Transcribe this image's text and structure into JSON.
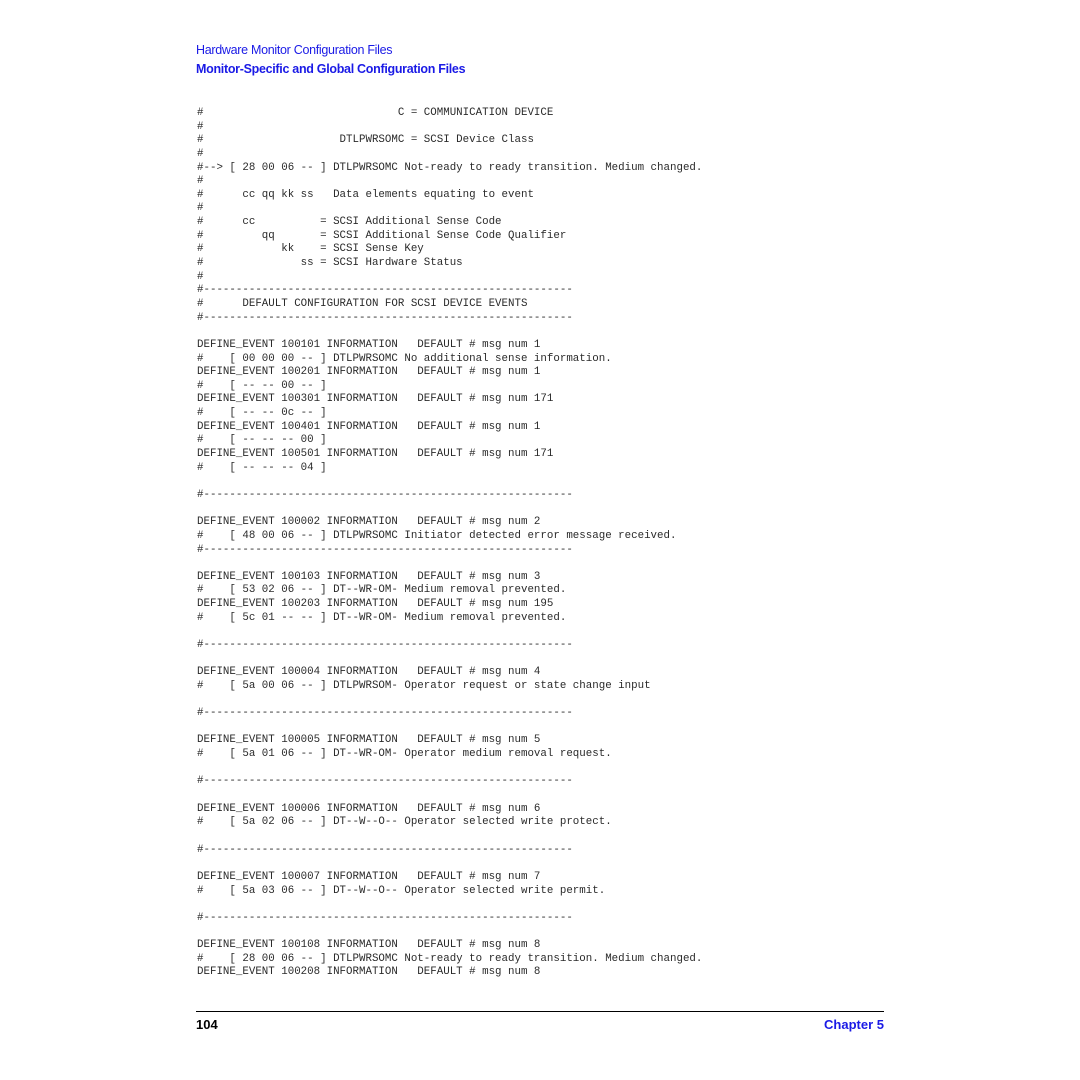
{
  "header": {
    "section": "Hardware Monitor Configuration Files",
    "title": "Monitor-Specific and Global Configuration Files"
  },
  "code_lines": [
    "#                              C = COMMUNICATION DEVICE",
    "#",
    "#                     DTLPWRSOMC = SCSI Device Class",
    "#",
    "#--> [ 28 00 06 -- ] DTLPWRSOMC Not-ready to ready transition. Medium changed.",
    "#",
    "#      cc qq kk ss   Data elements equating to event",
    "#",
    "#      cc          = SCSI Additional Sense Code",
    "#         qq       = SCSI Additional Sense Code Qualifier",
    "#            kk    = SCSI Sense Key",
    "#               ss = SCSI Hardware Status",
    "#",
    "#---------------------------------------------------------",
    "#      DEFAULT CONFIGURATION FOR SCSI DEVICE EVENTS",
    "#---------------------------------------------------------",
    "",
    "DEFINE_EVENT 100101 INFORMATION   DEFAULT # msg num 1",
    "#    [ 00 00 00 -- ] DTLPWRSOMC No additional sense information.",
    "DEFINE_EVENT 100201 INFORMATION   DEFAULT # msg num 1",
    "#    [ -- -- 00 -- ]",
    "DEFINE_EVENT 100301 INFORMATION   DEFAULT # msg num 171",
    "#    [ -- -- 0c -- ]",
    "DEFINE_EVENT 100401 INFORMATION   DEFAULT # msg num 1",
    "#    [ -- -- -- 00 ]",
    "DEFINE_EVENT 100501 INFORMATION   DEFAULT # msg num 171",
    "#    [ -- -- -- 04 ]",
    "",
    "#---------------------------------------------------------",
    "",
    "DEFINE_EVENT 100002 INFORMATION   DEFAULT # msg num 2",
    "#    [ 48 00 06 -- ] DTLPWRSOMC Initiator detected error message received.",
    "#---------------------------------------------------------",
    "",
    "DEFINE_EVENT 100103 INFORMATION   DEFAULT # msg num 3",
    "#    [ 53 02 06 -- ] DT--WR-OM- Medium removal prevented.",
    "DEFINE_EVENT 100203 INFORMATION   DEFAULT # msg num 195",
    "#    [ 5c 01 -- -- ] DT--WR-OM- Medium removal prevented.",
    "",
    "#---------------------------------------------------------",
    "",
    "DEFINE_EVENT 100004 INFORMATION   DEFAULT # msg num 4",
    "#    [ 5a 00 06 -- ] DTLPWRSOM- Operator request or state change input",
    "",
    "#---------------------------------------------------------",
    "",
    "DEFINE_EVENT 100005 INFORMATION   DEFAULT # msg num 5",
    "#    [ 5a 01 06 -- ] DT--WR-OM- Operator medium removal request.",
    "",
    "#---------------------------------------------------------",
    "",
    "DEFINE_EVENT 100006 INFORMATION   DEFAULT # msg num 6",
    "#    [ 5a 02 06 -- ] DT--W--O-- Operator selected write protect.",
    "",
    "#---------------------------------------------------------",
    "",
    "DEFINE_EVENT 100007 INFORMATION   DEFAULT # msg num 7",
    "#    [ 5a 03 06 -- ] DT--W--O-- Operator selected write permit.",
    "",
    "#---------------------------------------------------------",
    "",
    "DEFINE_EVENT 100108 INFORMATION   DEFAULT # msg num 8",
    "#    [ 28 00 06 -- ] DTLPWRSOMC Not-ready to ready transition. Medium changed.",
    "DEFINE_EVENT 100208 INFORMATION   DEFAULT # msg num 8"
  ],
  "footer": {
    "page_number": "104",
    "chapter": "Chapter 5"
  },
  "colors": {
    "heading_blue": "#1a1ae6",
    "body_text": "#2a2a2a"
  }
}
